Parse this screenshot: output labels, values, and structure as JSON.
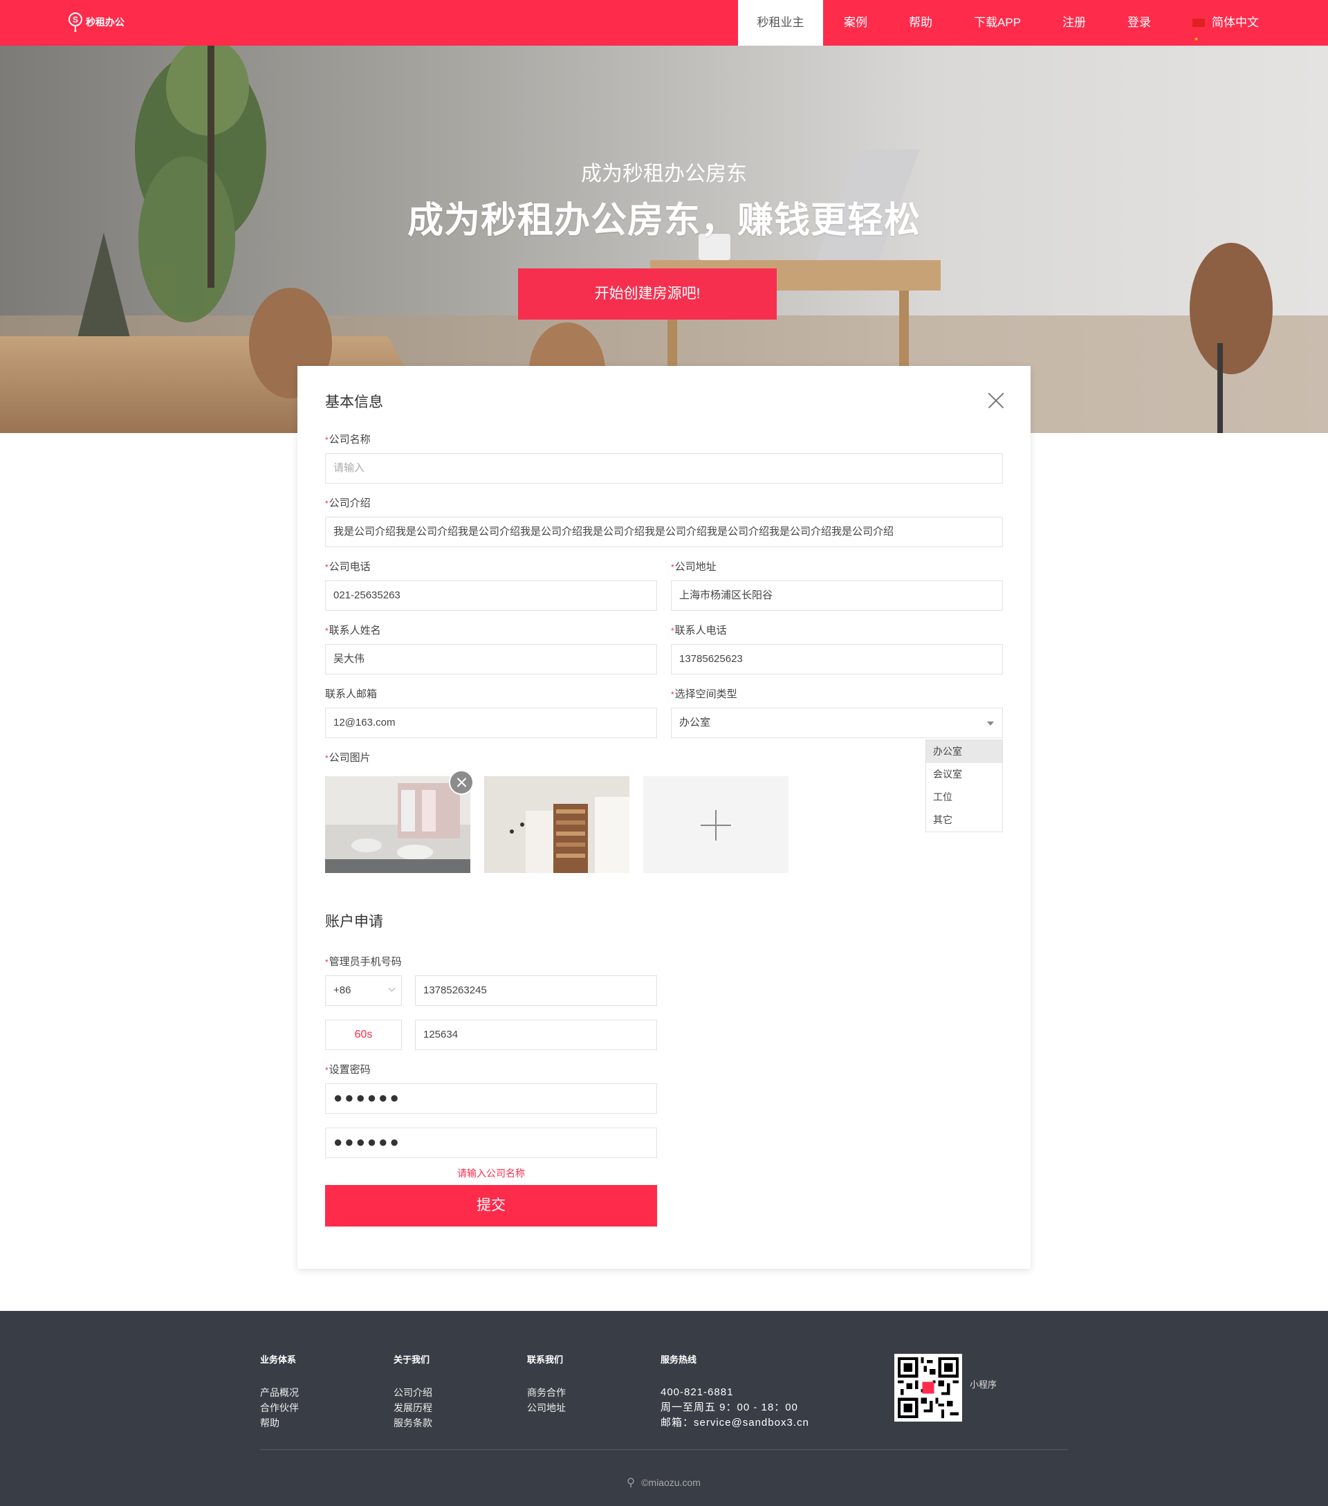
{
  "header": {
    "logo_text": "秒租办公",
    "nav": [
      "秒租业主",
      "案例",
      "帮助",
      "下载APP",
      "注册",
      "登录"
    ],
    "language": "简体中文"
  },
  "hero": {
    "subtitle": "成为秒租办公房东",
    "title": "成为秒租办公房东，赚钱更轻松",
    "cta": "开始创建房源吧!"
  },
  "form": {
    "section_basic": "基本信息",
    "company_name": {
      "label": "公司名称",
      "placeholder": "请输入"
    },
    "company_intro": {
      "label": "公司介绍",
      "value": "我是公司介绍我是公司介绍我是公司介绍我是公司介绍我是公司介绍我是公司介绍我是公司介绍我是公司介绍我是公司介绍"
    },
    "company_phone": {
      "label": "公司电话",
      "value": "021-25635263"
    },
    "company_address": {
      "label": "公司地址",
      "value": "上海市杨浦区长阳谷"
    },
    "contact_name": {
      "label": "联系人姓名",
      "value": "吴大伟"
    },
    "contact_phone": {
      "label": "联系人电话",
      "value": "13785625623"
    },
    "contact_email": {
      "label": "联系人邮箱",
      "value": "12@163.com"
    },
    "space_type": {
      "label": "选择空间类型",
      "value": "办公室",
      "options": [
        "办公室",
        "会议室",
        "工位",
        "其它"
      ]
    },
    "company_photos": {
      "label": "公司图片"
    },
    "section_account": "账户申请",
    "admin_phone": {
      "label": "管理员手机号码",
      "country_code": "+86",
      "value": "13785263245"
    },
    "verify": {
      "countdown": "60s",
      "code": "125634"
    },
    "password": {
      "label": "设置密码",
      "masked": "●●●●●●",
      "confirm_masked": "●●●●●●"
    },
    "error_text": "请输入公司名称",
    "submit": "提交"
  },
  "footer": {
    "columns": [
      {
        "title": "业务体系",
        "links": [
          "产品概况",
          "合作伙伴",
          "帮助"
        ]
      },
      {
        "title": "关于我们",
        "links": [
          "公司介绍",
          "发展历程",
          "服务条款"
        ]
      },
      {
        "title": "联系我们",
        "links": [
          "商务合作",
          "公司地址"
        ]
      }
    ],
    "hotline": {
      "title": "服务热线",
      "phone": "400-821-6881",
      "hours": "周一至周五 9：00 - 18：00",
      "email": "邮箱：service@sandbox3.cn"
    },
    "qr_label": "小程序",
    "copyright": "©miaozu.com"
  },
  "colors": {
    "brand": "#fe2b4b",
    "footer_bg": "#393d45"
  }
}
